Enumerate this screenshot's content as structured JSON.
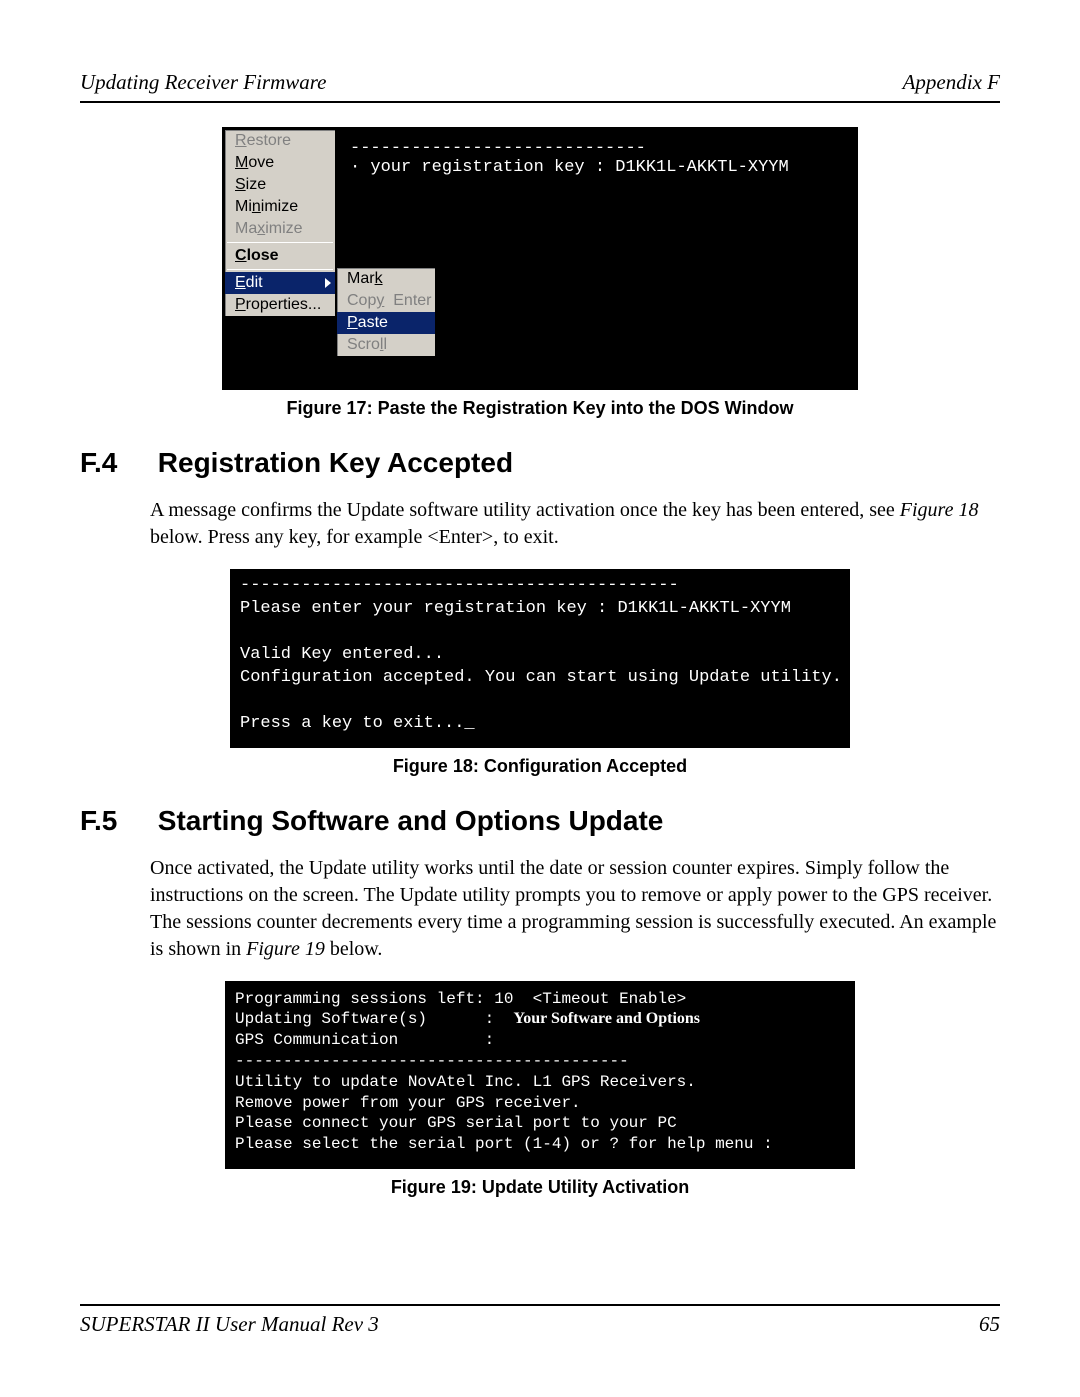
{
  "header": {
    "left": "Updating Receiver Firmware",
    "right": "Appendix F"
  },
  "footer": {
    "left": "SUPERSTAR II User Manual Rev 3",
    "right": "65"
  },
  "fig17": {
    "caption": "Figure 17: Paste the Registration Key into the DOS Window",
    "dos_line1": "-----------------------------",
    "dos_line2": "· your registration key : D1KK1L-AKKTL-XYYM",
    "menu": {
      "restore": "Restore",
      "move": "Move",
      "size": "Size",
      "minimize": "Minimize",
      "maximize": "Maximize",
      "close": "Close",
      "edit": "Edit",
      "properties": "Properties..."
    },
    "submenu": {
      "mark": "Mark",
      "copy": "Copy",
      "copy_hint": "Enter",
      "paste": "Paste",
      "scroll": "Scroll"
    }
  },
  "section_f4": {
    "num": "F.4",
    "title": "Registration Key Accepted",
    "para_a": "A message confirms the Update software utility activation once the key has been entered, see ",
    "para_figref": "Figure 18",
    "para_b": " below. Press any key, for example <Enter>, to exit."
  },
  "fig18": {
    "caption": "Figure 18: Configuration Accepted",
    "line1": "-------------------------------------------",
    "line2": "Please enter your registration key : D1KK1L-AKKTL-XYYM",
    "line3": "",
    "line4": "Valid Key entered...",
    "line5": "Configuration accepted. You can start using Update utility.",
    "line6": "",
    "line7": "Press a key to exit..._"
  },
  "section_f5": {
    "num": "F.5",
    "title": "Starting Software and Options Update",
    "para_a": "Once activated, the Update utility works until the date or session counter expires. Simply follow the instructions on the screen. The Update utility prompts you to remove or apply power to the GPS receiver. The sessions counter decrements every time a programming session is successfully executed. An example is shown in ",
    "para_figref": "Figure 19",
    "para_b": " below."
  },
  "fig19": {
    "caption": "Figure 19: Update Utility Activation",
    "line1": "Programming sessions left: 10  <Timeout Enable>",
    "line2a": "Updating Software(s)      :  ",
    "line2_label": "Your Software and Options",
    "line3": "GPS Communication         :",
    "line4": "",
    "line5": "",
    "line6": "-----------------------------------------",
    "line7": "",
    "line8": "Utility to update NovAtel Inc. L1 GPS Receivers.",
    "line9": "Remove power from your GPS receiver.",
    "line10": "Please connect your GPS serial port to your PC",
    "line11": "Please select the serial port (1-4) or ? for help menu :"
  }
}
